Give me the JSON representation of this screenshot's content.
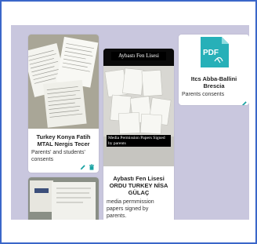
{
  "cards": [
    {
      "title_line1": "Turkey Konya Fatih",
      "title_line2": "MTAL Nergis Tecer",
      "desc_line1": "Parents' and students'",
      "desc_line2": "consents"
    },
    {
      "header_text": "Aybastı Fen Lisesi",
      "caption_line1": "Media Permission Papers Signed",
      "caption_line2": "by parents",
      "title_line1": "Aybastı Fen Lisesi",
      "title_line2": "ORDU TURKEY NİSA",
      "title_line3": "GÜLAÇ",
      "desc_line1": "media permmission",
      "desc_line2": "papers signed by",
      "desc_line3": "parents."
    },
    {
      "pdf_label": "PDF",
      "title_line1": "Itcs Abba-Ballini",
      "title_line2": "Brescia",
      "desc_line1": "Parents consents"
    }
  ],
  "colors": {
    "frame_border": "#3b66c9",
    "board_bg": "#c9c7de",
    "accent": "#1aa3a3",
    "pdf_tile": "#27b0b8"
  },
  "icons": [
    "pencil-icon",
    "trash-icon",
    "pdf-file-icon"
  ]
}
